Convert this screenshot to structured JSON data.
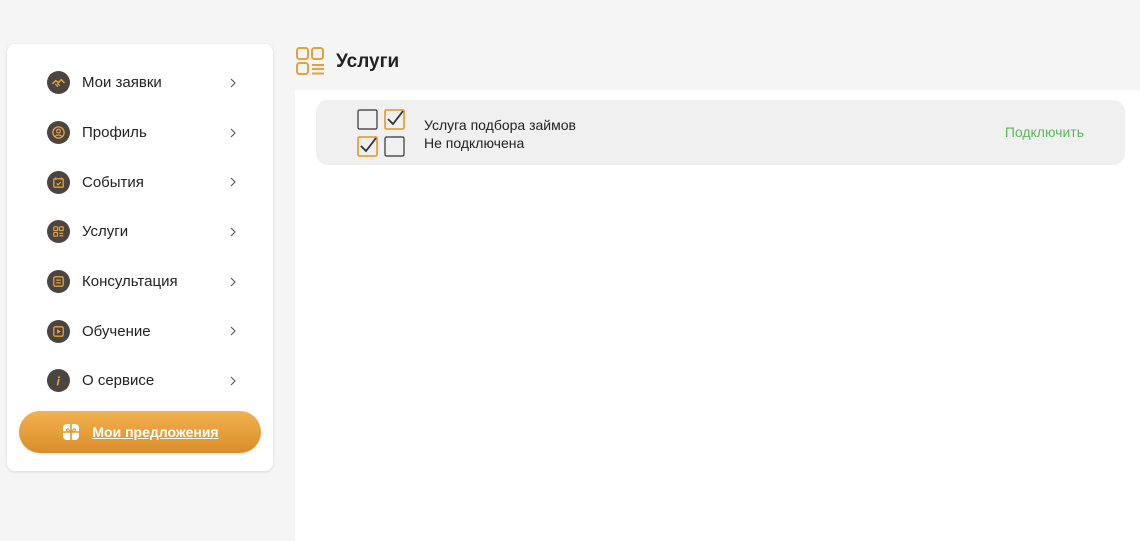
{
  "colors": {
    "accent": "#e5a23a",
    "icon_bg": "#4a4540",
    "connect": "#5cb85c",
    "card_bg": "#f0f0f0"
  },
  "sidebar": {
    "items": [
      {
        "label": "Мои заявки",
        "icon": "handshake-icon"
      },
      {
        "label": "Профиль",
        "icon": "user-icon"
      },
      {
        "label": "События",
        "icon": "calendar-icon"
      },
      {
        "label": "Услуги",
        "icon": "services-grid-icon"
      },
      {
        "label": "Консультация",
        "icon": "chat-icon"
      },
      {
        "label": "Обучение",
        "icon": "video-icon"
      },
      {
        "label": "О сервисе",
        "icon": "info-icon"
      }
    ],
    "offers_button": {
      "label": "Мои предложения",
      "icon": "gift-icon"
    }
  },
  "main": {
    "title": "Услуги",
    "title_icon": "services-grid-icon",
    "services": [
      {
        "name": "Услуга подбора займов",
        "status": "Не подключена",
        "action": "Подключить",
        "logo_icon": "checkbox-grid-icon"
      }
    ]
  }
}
